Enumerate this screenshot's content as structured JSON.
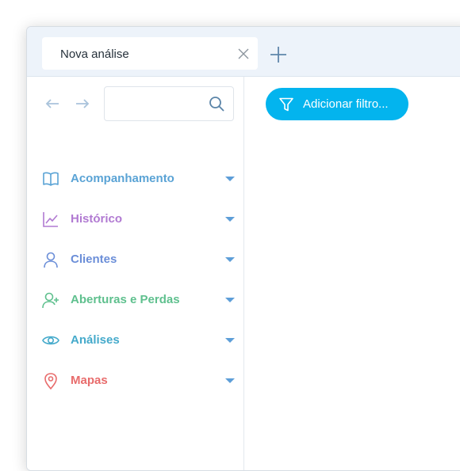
{
  "tab": {
    "title": "Nova análise"
  },
  "search": {
    "placeholder": ""
  },
  "menu": [
    {
      "label": "Acompanhamento",
      "icon": "book-open-icon",
      "color": "#5aa3d5"
    },
    {
      "label": "Histórico",
      "icon": "line-chart-icon",
      "color": "#b17ad2"
    },
    {
      "label": "Clientes",
      "icon": "user-icon",
      "color": "#6b8ed8"
    },
    {
      "label": "Aberturas e Perdas",
      "icon": "user-plus-icon",
      "color": "#5fc08e"
    },
    {
      "label": "Análises",
      "icon": "eye-icon",
      "color": "#45aacb"
    },
    {
      "label": "Mapas",
      "icon": "map-pin-icon",
      "color": "#e86c6c"
    }
  ],
  "filter": {
    "label": "Adicionar filtro..."
  },
  "colors": {
    "accent": "#03b4ee",
    "caret": "#5d9ed8"
  }
}
